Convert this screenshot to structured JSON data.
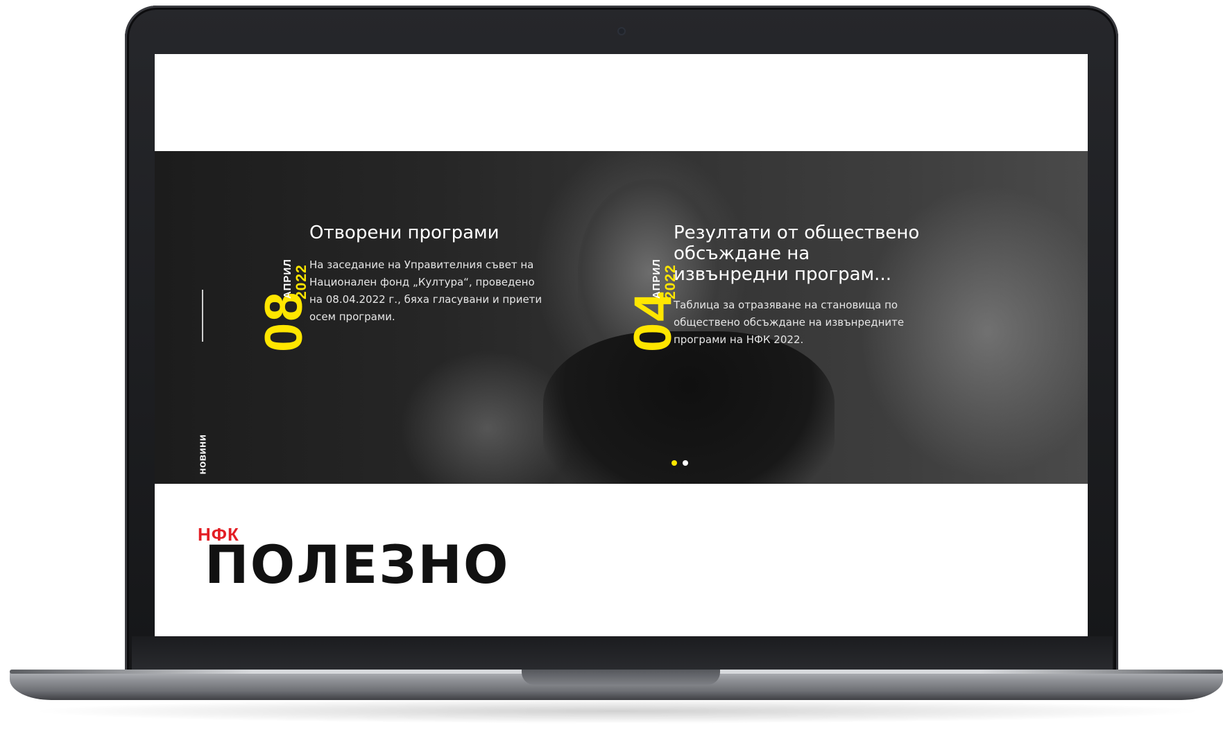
{
  "section_label": "новини",
  "news": [
    {
      "day": "08",
      "month": "АПРИЛ",
      "year": "2022",
      "title": "Отворени програми",
      "text": "На заседание на Управителния съвет на Национален фонд „Култура“, проведено на 08.04.2022 г., бяха гласувани и приети осем програми."
    },
    {
      "day": "04",
      "month": "АПРИЛ",
      "year": "2022",
      "title": "Резултати от обществено обсъждане на извънредни програм...",
      "text": "Таблица за отразяване на становища по обществено обсъждане на извънредните програми на НФК 2022."
    }
  ],
  "carousel": {
    "dot_active_color": "#ffe600",
    "dot_inactive_color": "#ffffff"
  },
  "useful": {
    "subtitle": "НФК",
    "title": "ПОЛЕЗНО"
  },
  "colors": {
    "accent_yellow": "#ffe600",
    "accent_red": "#e31e24"
  }
}
